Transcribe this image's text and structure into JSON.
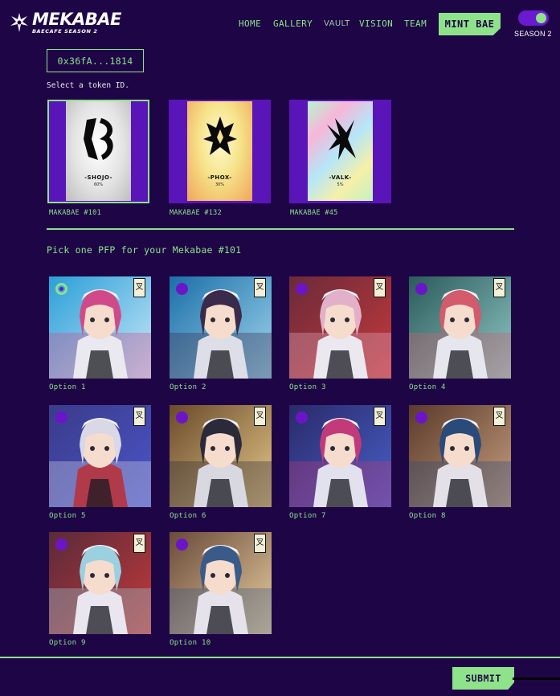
{
  "brand": {
    "name": "MEKABAE",
    "subtitle": "BAECAFE SEASON 2",
    "logo_icon": "star-burst-icon"
  },
  "nav": {
    "items": [
      {
        "label": "HOME"
      },
      {
        "label": "GALLERY"
      },
      {
        "label": "VAULT"
      },
      {
        "label": "VISION"
      },
      {
        "label": "TEAM"
      }
    ],
    "cta_label": "MINT BAE",
    "toggle_label": "SEASON 2",
    "toggle_on": true
  },
  "wallet": {
    "address": "0x36fA...1814"
  },
  "token_section": {
    "hint": "Select a token ID.",
    "tokens": [
      {
        "label": "MAKABAE #101",
        "card_name": "-SHOJO-",
        "card_percent": "60%",
        "selected": true
      },
      {
        "label": "MAKABAE #132",
        "card_name": "-PHOX-",
        "card_percent": "30%",
        "selected": false
      },
      {
        "label": "MAKABAE #45",
        "card_name": "-VALK-",
        "card_percent": "5%",
        "selected": false
      }
    ]
  },
  "pfp_section": {
    "title": "Pick one PFP for your Mekabae #101",
    "stamp_glyph": "叉",
    "options": [
      {
        "label": "Option 1",
        "selected": true
      },
      {
        "label": "Option 2",
        "selected": false
      },
      {
        "label": "Option 3",
        "selected": false
      },
      {
        "label": "Option 4",
        "selected": false
      },
      {
        "label": "Option 5",
        "selected": false
      },
      {
        "label": "Option 6",
        "selected": false
      },
      {
        "label": "Option 7",
        "selected": false
      },
      {
        "label": "Option 8",
        "selected": false
      },
      {
        "label": "Option 9",
        "selected": false
      },
      {
        "label": "Option 10",
        "selected": false
      }
    ]
  },
  "submit_label": "SUBMIT",
  "colors": {
    "background": "#1e0646",
    "accent": "#8ee28a",
    "purple": "#6a16c8"
  }
}
